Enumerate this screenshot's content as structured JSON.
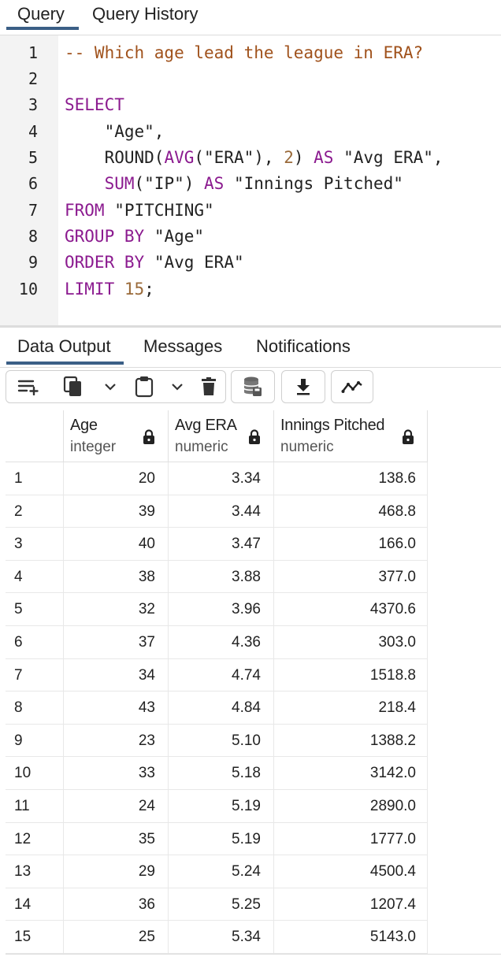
{
  "top_tabs": [
    {
      "label": "Query",
      "active": true
    },
    {
      "label": "Query History",
      "active": false
    }
  ],
  "editor": {
    "line_numbers": [
      "1",
      "2",
      "3",
      "4",
      "5",
      "6",
      "7",
      "8",
      "9",
      "10"
    ],
    "lines": {
      "l1_comment": "-- Which age lead the league in ERA?",
      "l3_select": "SELECT",
      "l4_age": "\"Age\",",
      "l5_round": "ROUND(",
      "l5_avg": "AVG",
      "l5_era": "(\"ERA\"),",
      "l5_two": "2",
      "l5_close": ")",
      "l5_as": "AS",
      "l5_alias": "\"Avg ERA\",",
      "l6_sum": "SUM",
      "l6_ip": "(\"IP\")",
      "l6_as": "AS",
      "l6_alias": "\"Innings Pitched\"",
      "l7_from": "FROM",
      "l7_table": "\"PITCHING\"",
      "l8_group": "GROUP BY",
      "l8_col": "\"Age\"",
      "l9_order": "ORDER BY",
      "l9_col": "\"Avg ERA\"",
      "l10_limit": "LIMIT",
      "l10_num": "15",
      "l10_semi": ";"
    }
  },
  "result_tabs": [
    {
      "label": "Data Output",
      "active": true
    },
    {
      "label": "Messages",
      "active": false
    },
    {
      "label": "Notifications",
      "active": false
    }
  ],
  "toolbar_icons": [
    "add-row-icon",
    "copy-icon",
    "chevron-down-icon",
    "paste-icon",
    "chevron-down-icon",
    "delete-icon",
    "save-data-icon",
    "download-icon",
    "graph-visualiser-icon"
  ],
  "grid": {
    "columns": [
      {
        "name": "Age",
        "type": "integer"
      },
      {
        "name": "Avg ERA",
        "type": "numeric"
      },
      {
        "name": "Innings Pitched",
        "type": "numeric"
      }
    ],
    "rows": [
      [
        "1",
        "20",
        "3.34",
        "138.6"
      ],
      [
        "2",
        "39",
        "3.44",
        "468.8"
      ],
      [
        "3",
        "40",
        "3.47",
        "166.0"
      ],
      [
        "4",
        "38",
        "3.88",
        "377.0"
      ],
      [
        "5",
        "32",
        "3.96",
        "4370.6"
      ],
      [
        "6",
        "37",
        "4.36",
        "303.0"
      ],
      [
        "7",
        "34",
        "4.74",
        "1518.8"
      ],
      [
        "8",
        "43",
        "4.84",
        "218.4"
      ],
      [
        "9",
        "23",
        "5.10",
        "1388.2"
      ],
      [
        "10",
        "33",
        "5.18",
        "3142.0"
      ],
      [
        "11",
        "24",
        "5.19",
        "2890.0"
      ],
      [
        "12",
        "35",
        "5.19",
        "1777.0"
      ],
      [
        "13",
        "29",
        "5.24",
        "4500.4"
      ],
      [
        "14",
        "36",
        "5.25",
        "1207.4"
      ],
      [
        "15",
        "25",
        "5.34",
        "5143.0"
      ]
    ]
  },
  "colors": {
    "keyword": "#8b1a8f",
    "comment": "#a0521c",
    "number": "#9a6a3a",
    "tab_indicator": "#3b5f86"
  }
}
